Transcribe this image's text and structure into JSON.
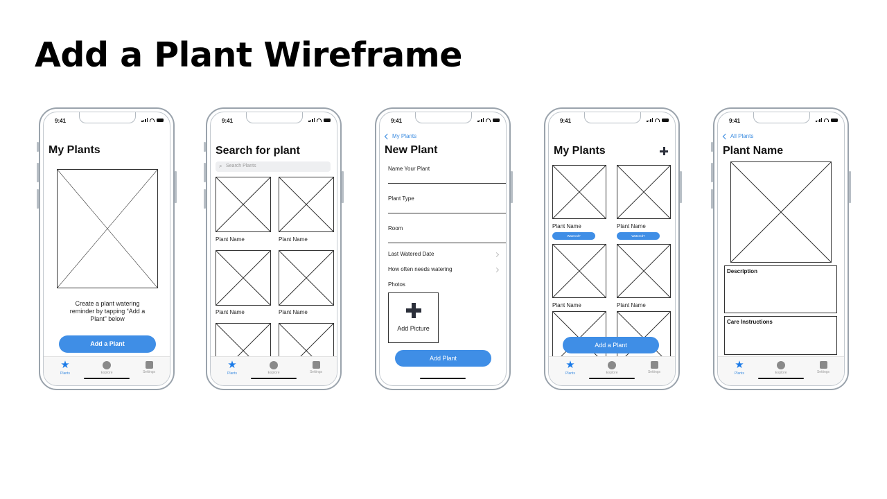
{
  "page": {
    "title": "Add a Plant Wireframe"
  },
  "status": {
    "time": "9:41"
  },
  "tabs": [
    {
      "label": "Plants",
      "icon": "star-icon"
    },
    {
      "label": "Explore",
      "icon": "circle-icon"
    },
    {
      "label": "Settings",
      "icon": "square-icon"
    }
  ],
  "screen1": {
    "title": "My Plants",
    "message": "Create a plant watering reminder by tapping “Add a Plant” below",
    "button": "Add a Plant"
  },
  "screen2": {
    "title": "Search for plant",
    "search_placeholder": "Search Plants",
    "item_label": "Plant Name"
  },
  "screen3": {
    "back": "My Plants",
    "title": "New Plant",
    "fields": [
      "Name Your Plant",
      "Plant Type",
      "Room"
    ],
    "rows": [
      "Last Watered Date",
      "How often needs watering"
    ],
    "photos_label": "Photos",
    "add_picture": "Add Picture",
    "button": "Add Plant"
  },
  "screen4": {
    "title": "My Plants",
    "item_label": "Plant Name",
    "watered_label": "Watered?",
    "button": "Add a Plant"
  },
  "screen5": {
    "back": "All Plants",
    "title": "Plant Name",
    "description_label": "Description",
    "care_label": "Care Instructions"
  },
  "colors": {
    "accent": "#3f8ee6",
    "tab_active": "#1a7ae8",
    "frame": "#9aa3ac"
  }
}
